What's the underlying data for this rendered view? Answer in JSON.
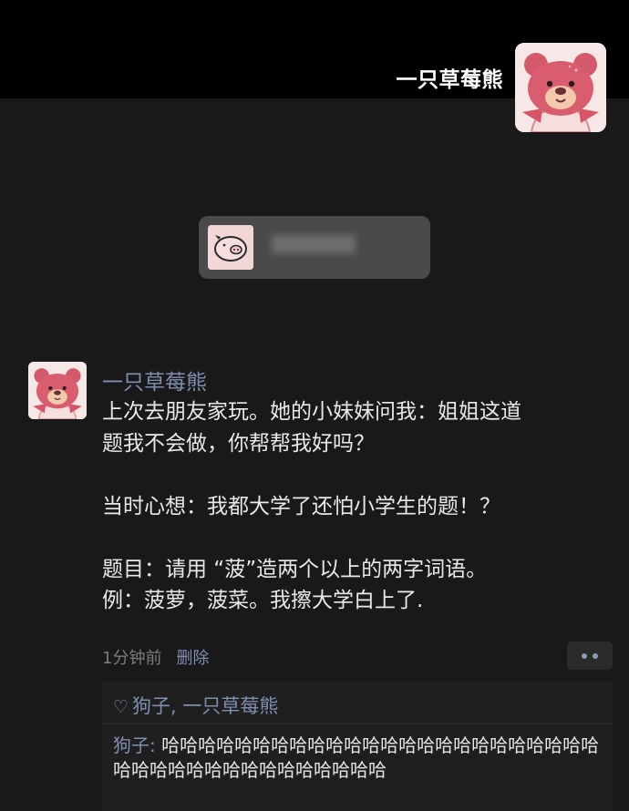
{
  "header": {
    "name": "一只草莓熊"
  },
  "post": {
    "author": "一只草莓熊",
    "content_lines": [
      "上次去朋友家玩。她的小妹妹问我：姐姐这道",
      "题我不会做，你帮帮我好吗？",
      "",
      "当时心想：我都大学了还怕小学生的题！？",
      "",
      "题目：请用 “菠”造两个以上的两字词语。",
      "例：菠萝，菠菜。我擦大学白上了."
    ],
    "time": "1分钟前",
    "delete_label": "删除"
  },
  "likes": {
    "heart_icon": "♡",
    "names": "狗子, 一只草莓熊"
  },
  "comment": {
    "author": "狗子:",
    "text": " 哈哈哈哈哈哈哈哈哈哈哈哈哈哈哈哈哈哈哈哈哈哈哈哈哈哈哈哈哈哈哈哈哈哈哈哈哈哈哈"
  },
  "mini_card": {
    "blurred_text": "███████"
  },
  "colors": {
    "accent_link": "#7f8fb0",
    "background": "#191919",
    "header_bg": "#000000"
  }
}
